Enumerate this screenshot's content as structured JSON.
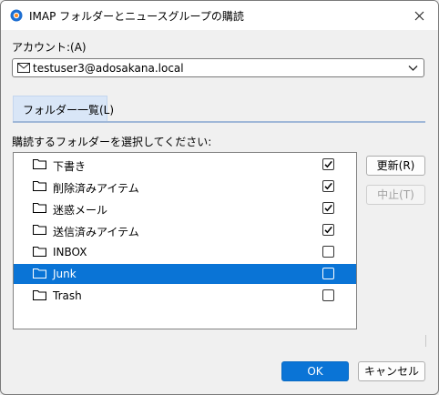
{
  "window": {
    "title": "IMAP フォルダーとニュースグループの購読"
  },
  "account": {
    "label": "アカウント:(A)",
    "value": "testuser3@adosakana.local"
  },
  "tab": {
    "label": "フォルダー一覧(L)"
  },
  "list": {
    "label": "購読するフォルダーを選択してください:",
    "folders": [
      {
        "name": "下書き",
        "checked": true
      },
      {
        "name": "削除済みアイテム",
        "checked": true
      },
      {
        "name": "迷惑メール",
        "checked": true
      },
      {
        "name": "送信済みアイテム",
        "checked": true
      },
      {
        "name": "INBOX",
        "checked": false
      },
      {
        "name": "Junk",
        "checked": false,
        "selected": true
      },
      {
        "name": "Trash",
        "checked": false
      }
    ]
  },
  "buttons": {
    "refresh": "更新(R)",
    "stop": "中止(T)",
    "ok": "OK",
    "cancel": "キャンセル"
  },
  "colors": {
    "selection": "#0a74d6",
    "tab_bg": "#d9e6f7",
    "primary": "#0a74d6"
  }
}
